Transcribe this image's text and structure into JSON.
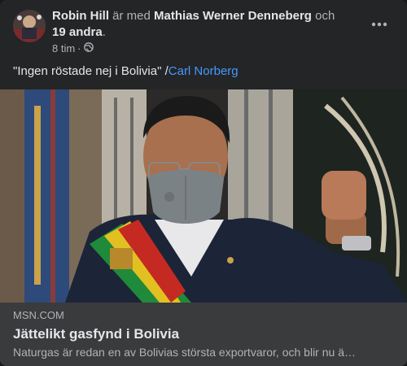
{
  "header": {
    "author": "Robin Hill",
    "connector": "är med",
    "tagged_person": "Mathias Werner Denneberg",
    "and": "och",
    "others": "19 andra",
    "period": ".",
    "time": "8 tim",
    "separator": "·",
    "audience_icon": "globe-icon",
    "more_icon": "more-options-icon"
  },
  "post": {
    "text": "\"Ingen röstade nej i Bolivia\" /",
    "mention": "Carl Norberg"
  },
  "link_preview": {
    "domain": "MSN.COM",
    "title": "Jättelikt gasfynd i Bolivia",
    "description": "Naturgas är redan en av Bolivias största exportvaror, och blir nu ä…"
  },
  "colors": {
    "background": "#242526",
    "text_primary": "#e4e6eb",
    "text_secondary": "#b0b3b8",
    "link": "#4599ff",
    "card": "#3a3b3c"
  }
}
